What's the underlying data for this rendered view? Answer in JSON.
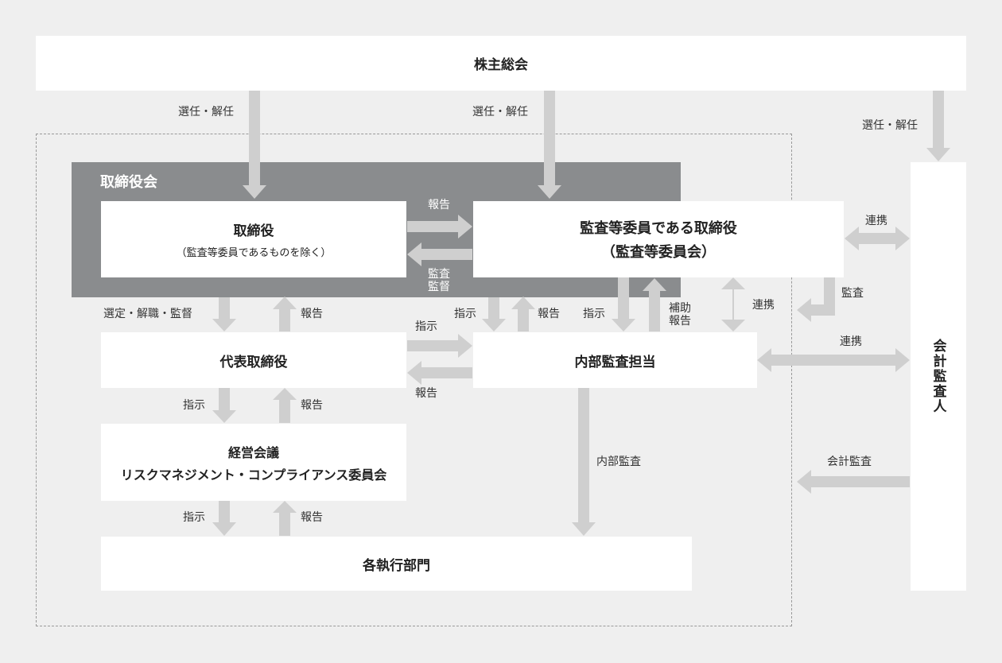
{
  "colors": {
    "background": "#efefef",
    "board": "#8a8c8e",
    "arrow": "#cfcfcf",
    "box": "#ffffff",
    "dashed_border": "#999999"
  },
  "nodes": {
    "shareholders": "株主総会",
    "board_of_directors": "取締役会",
    "directors": {
      "title": "取締役",
      "subtitle": "（監査等委員であるものを除く）"
    },
    "audit_directors": {
      "line1": "監査等委員である取締役",
      "line2": "（監査等委員会）"
    },
    "representative": "代表取締役",
    "internal_audit": "内部監査担当",
    "management": {
      "line1": "経営会議",
      "line2": "リスクマネジメント・コンプライアンス委員会"
    },
    "departments": "各執行部門",
    "accounting_auditor": "会計監査人"
  },
  "labels": {
    "elect_dismiss_1": "選任・解任",
    "elect_dismiss_2": "選任・解任",
    "elect_dismiss_3": "選任・解任",
    "report_to_audit": "報告",
    "audit_supervise": "監査\n監督",
    "select_dismiss_supervise": "選定・解職・監督",
    "report_rep_board": "報告",
    "instruct_rep_internal": "指示",
    "report_internal_rep": "報告",
    "instruct_audit_internal_left": "指示",
    "report_internal_audit_left": "報告",
    "instruct_audit_internal": "指示",
    "assist_report": "補助\n報告",
    "coop_audit_auditor": "連携",
    "coop_internal_audit": "連携",
    "audit_by_auditor": "監査",
    "coop_internal_auditor": "連携",
    "instruct_rep_mgmt": "指示",
    "report_mgmt_rep": "報告",
    "internal_audit_line": "内部監査",
    "accounting_audit": "会計監査",
    "instruct_mgmt_dept": "指示",
    "report_dept_mgmt": "報告"
  }
}
